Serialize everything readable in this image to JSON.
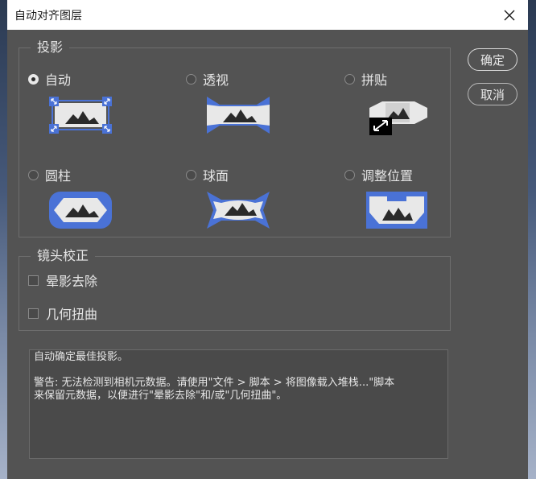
{
  "window": {
    "title": "自动对齐图层"
  },
  "projection": {
    "legend": "投影",
    "options": [
      {
        "label": "自动",
        "selected": true,
        "icon": "auto-projection-icon"
      },
      {
        "label": "透视",
        "selected": false,
        "icon": "perspective-projection-icon"
      },
      {
        "label": "拼贴",
        "selected": false,
        "icon": "collage-projection-icon"
      },
      {
        "label": "圆柱",
        "selected": false,
        "icon": "cylindrical-projection-icon"
      },
      {
        "label": "球面",
        "selected": false,
        "icon": "spherical-projection-icon"
      },
      {
        "label": "调整位置",
        "selected": false,
        "icon": "reposition-projection-icon"
      }
    ]
  },
  "lens": {
    "legend": "镜头校正",
    "options": [
      {
        "label": "晕影去除",
        "checked": false
      },
      {
        "label": "几何扭曲",
        "checked": false
      }
    ]
  },
  "buttons": {
    "ok": "确定",
    "cancel": "取消"
  },
  "info": {
    "line1": "自动确定最佳投影。",
    "line2": "警告: 无法检测到相机元数据。请使用\"文件 > 脚本 > 将图像载入堆栈...\"脚本",
    "line3": "来保留元数据，以便进行\"晕影去除\"和/或\"几何扭曲\"。"
  },
  "colors": {
    "accent": "#4a72d6",
    "panel": "#535353",
    "icon_fill": "#e8e8e8"
  }
}
